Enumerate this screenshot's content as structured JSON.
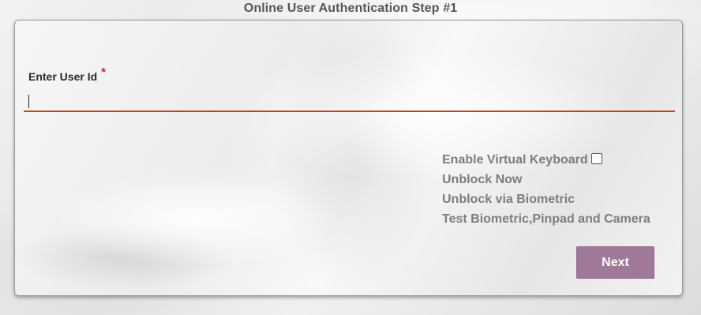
{
  "page": {
    "title": "Online User Authentication Step #1"
  },
  "form": {
    "user_id_label": "Enter User Id",
    "required_marker": "*",
    "user_id_value": "",
    "user_id_placeholder": ""
  },
  "options": {
    "virtual_keyboard_label": "Enable Virtual Keyboard",
    "virtual_keyboard_checked": false,
    "unblock_now": "Unblock Now",
    "unblock_biometric": "Unblock via Biometric",
    "test_devices": "Test Biometric,Pinpad and Camera"
  },
  "actions": {
    "next_label": "Next"
  },
  "colors": {
    "input_underline": "#c8401a",
    "required_star": "#cc2222",
    "next_button_bg": "#a07898",
    "link_text": "#7d7d7d"
  }
}
